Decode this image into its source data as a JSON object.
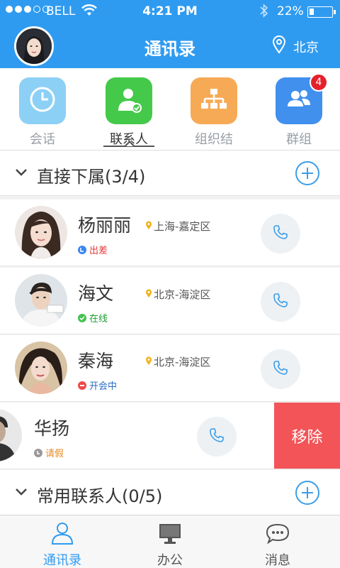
{
  "status_bar": {
    "carrier": "BELL",
    "time": "4:21 PM",
    "battery": "22%",
    "battery_level": 0.22
  },
  "header": {
    "title": "通讯录",
    "location": "北京"
  },
  "tabs": [
    {
      "label": "会话",
      "icon": "clock-icon",
      "color": "#8dd0f6"
    },
    {
      "label": "联系人",
      "icon": "contact-icon",
      "color": "#45c94a",
      "active": true
    },
    {
      "label": "组织结构",
      "icon": "org-chart-icon",
      "color": "#f7aa55"
    },
    {
      "label": "群组",
      "icon": "group-icon",
      "color": "#4190ee",
      "badge": "4"
    }
  ],
  "sections": {
    "direct": {
      "title": "直接下属(3/4)"
    },
    "frequent": {
      "title": "常用联系人(0/5)"
    }
  },
  "contacts": [
    {
      "name": "杨丽丽",
      "location": "上海-嘉定区",
      "status": "出差",
      "status_color": "#3a86f0",
      "status_text_color": "#e53935"
    },
    {
      "name": "海文",
      "location": "北京-海淀区",
      "status": "在线",
      "status_color": "#43c24c",
      "status_text_color": "#1e9c2f"
    },
    {
      "name": "秦海",
      "location": "北京-海淀区",
      "status": "开会中",
      "status_color": "#ee4a4a",
      "status_text_color": "#2a6bc4"
    },
    {
      "name": "华扬",
      "status": "请假",
      "status_color": "#999999",
      "status_text_color": "#e88b23",
      "swipe_action": "移除"
    }
  ],
  "bottom_nav": [
    {
      "label": "通讯录",
      "icon": "person-icon",
      "active": true
    },
    {
      "label": "办公",
      "icon": "monitor-icon"
    },
    {
      "label": "消息",
      "icon": "chat-bubble-icon"
    }
  ],
  "colors": {
    "primary": "#2f9bf0",
    "remove": "#f25458"
  }
}
